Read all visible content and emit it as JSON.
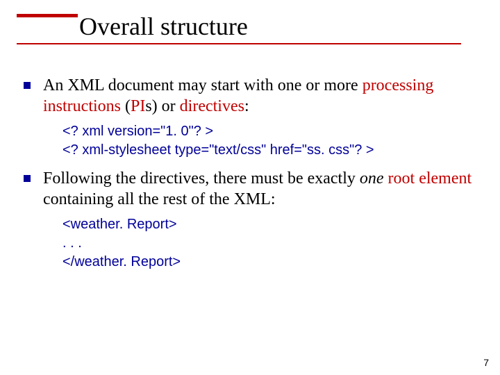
{
  "title": "Overall structure",
  "points": [
    {
      "text_pre": "An XML document may start with one or more ",
      "text_red1": "processing instructions",
      "text_mid1": " (",
      "text_red2": "PI",
      "text_mid2": "s) or ",
      "text_red3": "directives",
      "text_post": ":",
      "code": [
        "<? xml version=\"1. 0\"? >",
        "<? xml-stylesheet type=\"text/css\" href=\"ss. css\"? >"
      ]
    },
    {
      "text_pre": "Following the directives, there must be exactly ",
      "text_ital": "one",
      "text_mid1": " ",
      "text_red1": "root element",
      "text_post": " containing all the rest of the XML:",
      "code": [
        "<weather. Report>",
        "   . . .",
        "</weather. Report>"
      ]
    }
  ],
  "page_number": "7"
}
